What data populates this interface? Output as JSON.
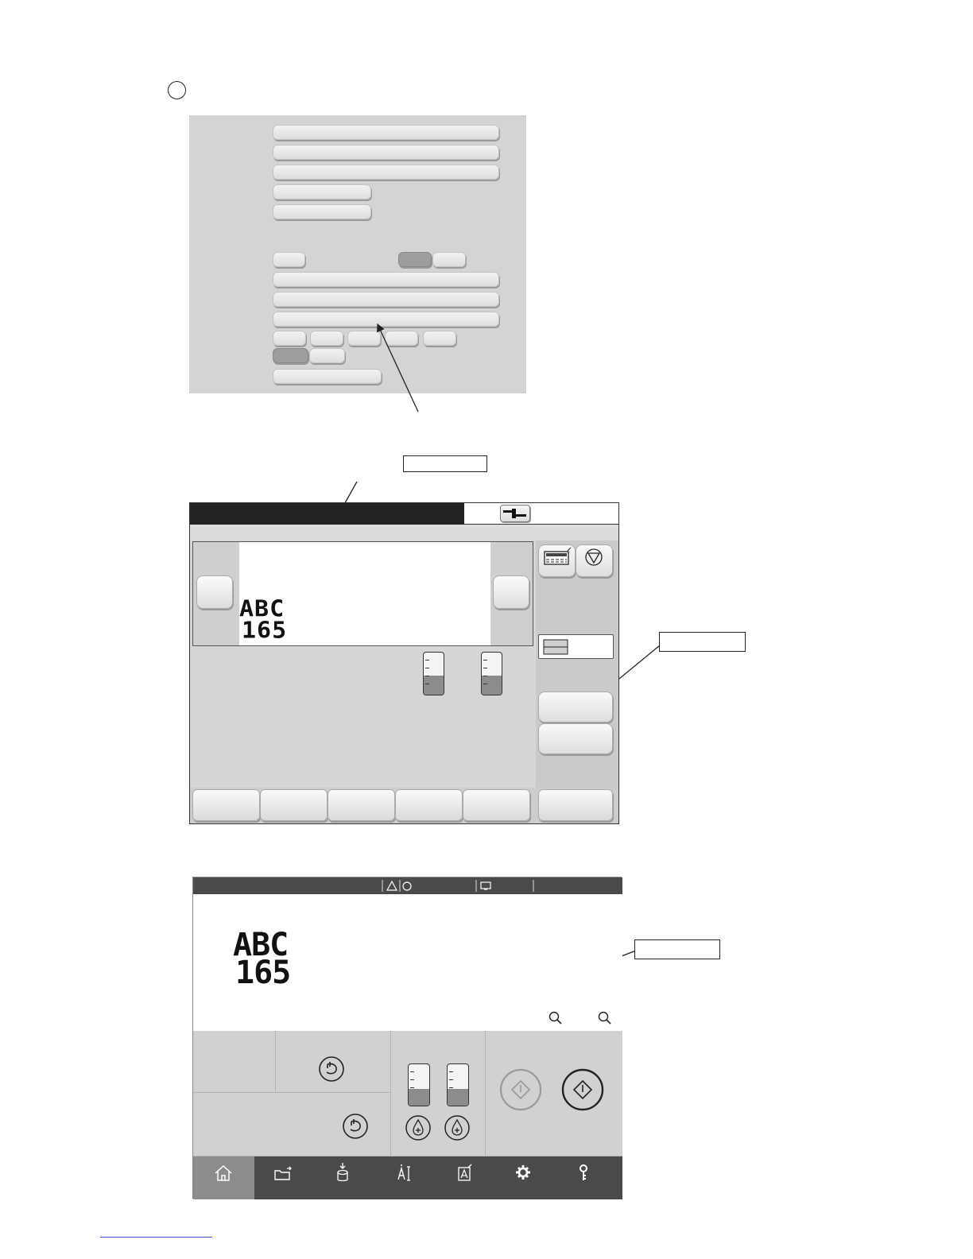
{
  "document": {
    "step_marker": "",
    "callouts": {
      "top": "",
      "right": "",
      "bottom": ""
    },
    "footer_link": ""
  },
  "panel_a": {
    "rows": [
      {
        "label": ""
      },
      {
        "label": ""
      },
      {
        "label": ""
      },
      {
        "label": ""
      },
      {
        "label": ""
      }
    ],
    "option_buttons": [
      "",
      "",
      ""
    ],
    "selected_option_index": 1
  },
  "panel_b": {
    "preview_text": {
      "line1": "ABC",
      "line2": "165"
    },
    "tanks": [
      {
        "level": 0.45
      },
      {
        "level": 0.45
      }
    ],
    "bottom_buttons": [
      "",
      "",
      "",
      "",
      ""
    ],
    "right_bottom_button": "",
    "icons": [
      "connector-icon",
      "message-icon",
      "stop-icon",
      "layout-icon"
    ]
  },
  "panel_c": {
    "preview_text": {
      "line1": "ABC",
      "line2": "165"
    },
    "tanks": [
      {
        "level": 0.4
      },
      {
        "level": 0.4
      }
    ],
    "nav_items": [
      {
        "icon": "home-icon",
        "active": true
      },
      {
        "icon": "folder-icon",
        "active": false
      },
      {
        "icon": "ink-download-icon",
        "active": false
      },
      {
        "icon": "text-edit-icon",
        "active": false
      },
      {
        "icon": "text-frame-icon",
        "active": false
      },
      {
        "icon": "gear-icon",
        "active": false
      },
      {
        "icon": "key-icon",
        "active": false
      }
    ],
    "colors": {
      "topbar": "#4a4a4a",
      "nav_active": "#8c8c8c",
      "lower_panel": "#cfcfcf"
    }
  }
}
